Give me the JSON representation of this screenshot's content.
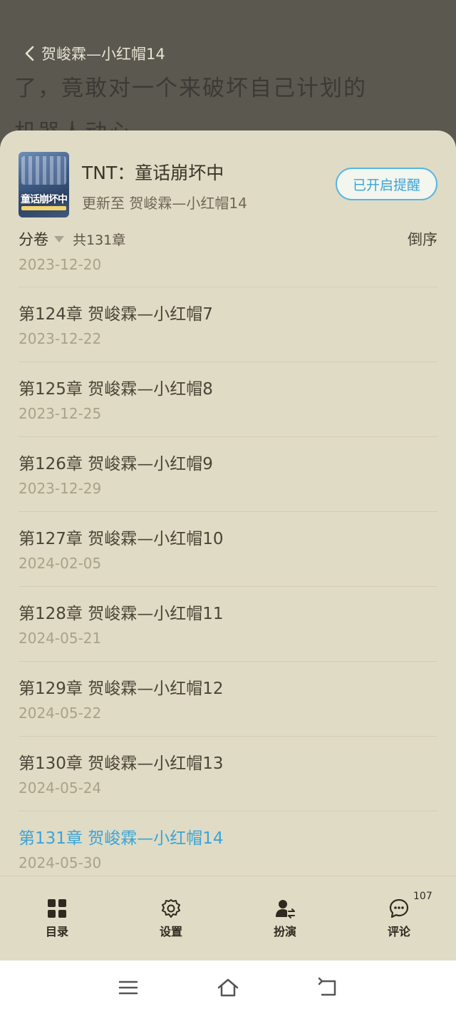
{
  "reader": {
    "back_title": "贺峻霖—小红帽14",
    "line1": "了，竟敢对一个来破坏自己计划的",
    "line2": "机器人动心"
  },
  "book": {
    "cover_title": "童话崩坏中",
    "title": "TNT：童话崩坏中",
    "update": "更新至 贺峻霖—小红帽14",
    "remind_label": "已开启提醒"
  },
  "volume": {
    "label": "分卷",
    "count": "共131章",
    "order_label": "倒序"
  },
  "first_date": "2023-12-20",
  "chapters": [
    {
      "title": "第124章 贺峻霖—小红帽7",
      "date": "2023-12-22"
    },
    {
      "title": "第125章 贺峻霖—小红帽8",
      "date": "2023-12-25"
    },
    {
      "title": "第126章 贺峻霖—小红帽9",
      "date": "2023-12-29"
    },
    {
      "title": "第127章 贺峻霖—小红帽10",
      "date": "2024-02-05"
    },
    {
      "title": "第128章 贺峻霖—小红帽11",
      "date": "2024-05-21"
    },
    {
      "title": "第129章 贺峻霖—小红帽12",
      "date": "2024-05-22"
    },
    {
      "title": "第130章 贺峻霖—小红帽13",
      "date": "2024-05-24"
    },
    {
      "title": "第131章 贺峻霖—小红帽14",
      "date": "2024-05-30"
    }
  ],
  "tabs": [
    {
      "label": "目录",
      "icon": "grid-icon"
    },
    {
      "label": "设置",
      "icon": "gear-icon"
    },
    {
      "label": "扮演",
      "icon": "person-swap-icon"
    },
    {
      "label": "评论",
      "icon": "comment-icon",
      "badge": "107"
    }
  ],
  "colors": {
    "sheet_bg": "#e0dbc5",
    "accent": "#3aa4d8",
    "date_text": "#aaa287"
  }
}
